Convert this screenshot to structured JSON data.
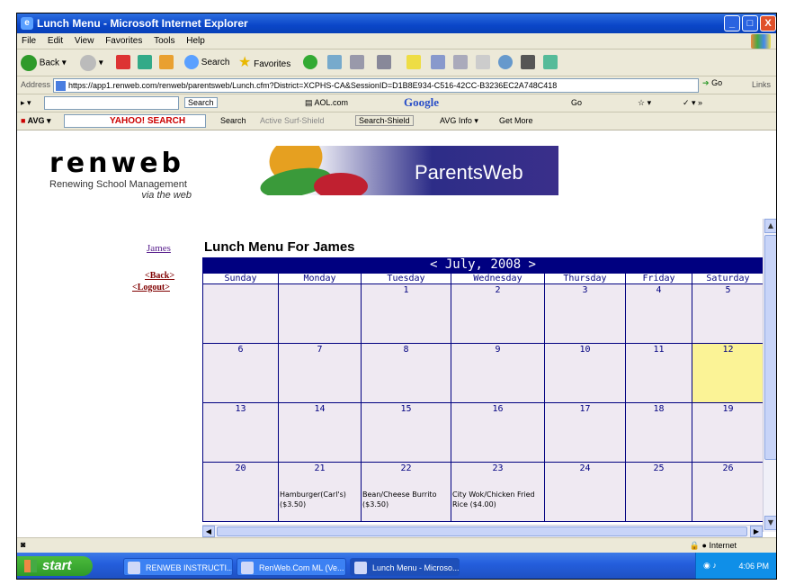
{
  "window": {
    "title": "Lunch Menu - Microsoft Internet Explorer",
    "min": "_",
    "max": "□",
    "close": "X"
  },
  "menubar": [
    "File",
    "Edit",
    "View",
    "Favorites",
    "Tools",
    "Help"
  ],
  "toolbar": {
    "back": "Back",
    "search": "Search",
    "favorites": "Favorites"
  },
  "address": {
    "label": "Address",
    "url": "https://app1.renweb.com/renweb/parentsweb/Lunch.cfm?District=XCPHS-CA&SessionID=D1B8E934-C516-42CC-B3236EC2A748C418",
    "go": "Go",
    "links": "Links"
  },
  "toolbar2": {
    "search_btn": "Search",
    "aol": "AOL.com",
    "google": "Google",
    "go": "Go"
  },
  "avgbar": {
    "avg": "AVG",
    "yahoo": "YAHOO! SEARCH",
    "search": "Search",
    "active_surf": "Active Surf-Shield",
    "search_shield": "Search-Shield",
    "avg_info": "AVG Info",
    "get_more": "Get More"
  },
  "logo": {
    "word": "renweb",
    "tagline": "Renewing School Management",
    "tagline2": "via the web"
  },
  "banner": {
    "text": "ParentsWeb"
  },
  "side": {
    "student": "James",
    "back": "<Back>",
    "logout": "<Logout>"
  },
  "page_title": "Lunch Menu For James",
  "calendar": {
    "header": "< July, 2008 >",
    "days": [
      "Sunday",
      "Monday",
      "Tuesday",
      "Wednesday",
      "Thursday",
      "Friday",
      "Saturday"
    ],
    "today": 12,
    "weeks": [
      [
        null,
        null,
        {
          "d": 1
        },
        {
          "d": 2
        },
        {
          "d": 3
        },
        {
          "d": 4
        },
        {
          "d": 5
        }
      ],
      [
        {
          "d": 6
        },
        {
          "d": 7
        },
        {
          "d": 8
        },
        {
          "d": 9
        },
        {
          "d": 10
        },
        {
          "d": 11
        },
        {
          "d": 12
        }
      ],
      [
        {
          "d": 13
        },
        {
          "d": 14
        },
        {
          "d": 15
        },
        {
          "d": 16
        },
        {
          "d": 17
        },
        {
          "d": 18
        },
        {
          "d": 19
        }
      ],
      [
        {
          "d": 20
        },
        {
          "d": 21,
          "menu": "Hamburger(Carl's)\n($3.50)"
        },
        {
          "d": 22,
          "menu": "Bean/Cheese Burrito\n($3.50)"
        },
        {
          "d": 23,
          "menu": "City Wok/Chicken Fried\nRice ($4.00)"
        },
        {
          "d": 24
        },
        {
          "d": 25
        },
        {
          "d": 26
        }
      ]
    ]
  },
  "statusbar": {
    "zone": "Internet"
  },
  "taskbar": {
    "start": "start",
    "tasks": [
      "RENWEB INSTRUCTI...",
      "RenWeb.Com ML (Ve...",
      "Lunch Menu - Microso..."
    ],
    "clock": "4:06 PM"
  },
  "colors": {
    "calendar_header": "#000080",
    "cell_bg": "#efe9f2",
    "today_bg": "#fbf396",
    "xp_blue": "#245edc"
  }
}
